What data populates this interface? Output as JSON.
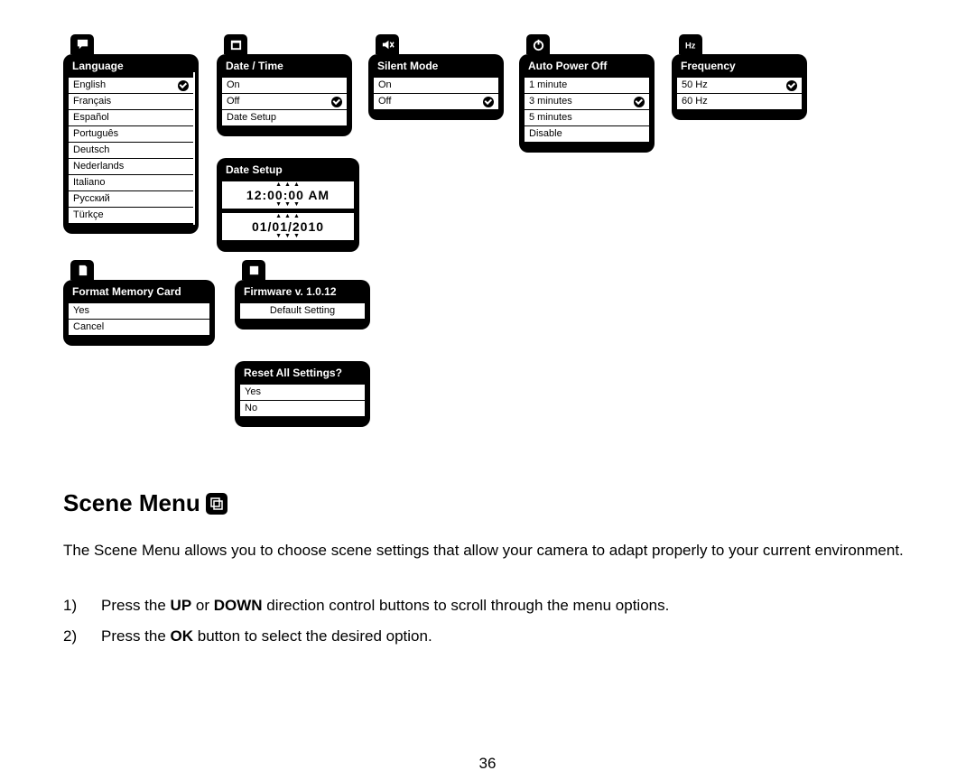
{
  "menus": {
    "language": {
      "title": "Language",
      "items": [
        "English",
        "Français",
        "Español",
        "Português",
        "Deutsch",
        "Nederlands",
        "Italiano",
        "Русский",
        "Türkçe"
      ],
      "checked": 0
    },
    "datetime": {
      "title": "Date / Time",
      "items": [
        "On",
        "Off",
        "Date Setup"
      ],
      "checked": 1
    },
    "datesetup": {
      "title": "Date Setup",
      "time": "12:00:00 AM",
      "date": "01/01/2010"
    },
    "silent": {
      "title": "Silent Mode",
      "items": [
        "On",
        "Off"
      ],
      "checked": 1
    },
    "autopower": {
      "title": "Auto Power Off",
      "items": [
        "1 minute",
        "3 minutes",
        "5 minutes",
        "Disable"
      ],
      "checked": 1
    },
    "frequency": {
      "title": "Frequency",
      "items": [
        "50 Hz",
        "60 Hz"
      ],
      "checked": 0
    },
    "format": {
      "title": "Format Memory Card",
      "items": [
        "Yes",
        "Cancel"
      ]
    },
    "firmware": {
      "title": "Firmware v. 1.0.12",
      "items": [
        "Default Setting"
      ]
    },
    "reset": {
      "title": "Reset All Settings?",
      "items": [
        "Yes",
        "No"
      ]
    }
  },
  "section": {
    "heading": "Scene Menu",
    "para": "The Scene Menu allows you to choose scene settings that allow your camera to adapt properly to your current environment.",
    "steps": {
      "s1_pre": "Press the ",
      "s1_b1": "UP",
      "s1_mid": " or ",
      "s1_b2": "DOWN",
      "s1_post": " direction control buttons to scroll through the menu options.",
      "s2_pre": "Press the ",
      "s2_b1": "OK",
      "s2_post": " button to select the desired option."
    },
    "num1": "1)",
    "num2": "2)"
  },
  "page_number": "36"
}
